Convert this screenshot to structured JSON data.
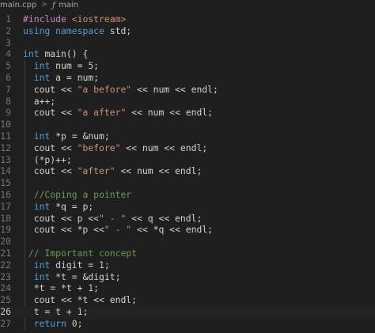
{
  "breadcrumb": {
    "file": "main.cpp",
    "separator": ">",
    "symbol_icon": "function-icon",
    "symbol": "main"
  },
  "editor": {
    "current_line": 26,
    "lines": [
      {
        "n": "1",
        "tokens": [
          [
            "pp",
            "#include "
          ],
          [
            "str",
            "<iostream>"
          ]
        ]
      },
      {
        "n": "2",
        "tokens": [
          [
            "kw",
            "using namespace "
          ],
          [
            "plain",
            "std;"
          ]
        ]
      },
      {
        "n": "3",
        "tokens": []
      },
      {
        "n": "4",
        "tokens": [
          [
            "kw",
            "int "
          ],
          [
            "plain",
            "main() {"
          ]
        ]
      },
      {
        "n": "5",
        "tokens": [
          [
            "plain",
            "  "
          ],
          [
            "kw",
            "int "
          ],
          [
            "plain",
            "num = "
          ],
          [
            "num",
            "5"
          ],
          [
            "plain",
            ";"
          ]
        ]
      },
      {
        "n": "6",
        "tokens": [
          [
            "plain",
            "  "
          ],
          [
            "kw",
            "int "
          ],
          [
            "plain",
            "a = num;"
          ]
        ]
      },
      {
        "n": "7",
        "tokens": [
          [
            "plain",
            "  cout << "
          ],
          [
            "str",
            "\"a before\""
          ],
          [
            "plain",
            " << num << endl;"
          ]
        ]
      },
      {
        "n": "8",
        "tokens": [
          [
            "plain",
            "  a++;"
          ]
        ]
      },
      {
        "n": "9",
        "tokens": [
          [
            "plain",
            "  cout << "
          ],
          [
            "str",
            "\"a after\""
          ],
          [
            "plain",
            " << num << endl;"
          ]
        ]
      },
      {
        "n": "10",
        "tokens": []
      },
      {
        "n": "11",
        "tokens": [
          [
            "plain",
            "  "
          ],
          [
            "kw",
            "int "
          ],
          [
            "plain",
            "*p = &num;"
          ]
        ]
      },
      {
        "n": "12",
        "tokens": [
          [
            "plain",
            "  cout << "
          ],
          [
            "str",
            "\"before\""
          ],
          [
            "plain",
            " << num << endl;"
          ]
        ]
      },
      {
        "n": "13",
        "tokens": [
          [
            "plain",
            "  (*p)++;"
          ]
        ]
      },
      {
        "n": "14",
        "tokens": [
          [
            "plain",
            "  cout << "
          ],
          [
            "str",
            "\"after\""
          ],
          [
            "plain",
            " << num << endl;"
          ]
        ]
      },
      {
        "n": "15",
        "tokens": []
      },
      {
        "n": "16",
        "tokens": [
          [
            "plain",
            "  "
          ],
          [
            "cm",
            "//Coping a pointer"
          ]
        ]
      },
      {
        "n": "17",
        "tokens": [
          [
            "plain",
            "  "
          ],
          [
            "kw",
            "int "
          ],
          [
            "plain",
            "*q = p;"
          ]
        ]
      },
      {
        "n": "18",
        "tokens": [
          [
            "plain",
            "  cout << p <<"
          ],
          [
            "str",
            "\" - \""
          ],
          [
            "plain",
            " << q << endl;"
          ]
        ]
      },
      {
        "n": "19",
        "tokens": [
          [
            "plain",
            "  cout << *p <<"
          ],
          [
            "str",
            "\" - \""
          ],
          [
            "plain",
            " << *q << endl;"
          ]
        ]
      },
      {
        "n": "20",
        "tokens": []
      },
      {
        "n": "21",
        "tokens": [
          [
            "plain",
            " "
          ],
          [
            "cm",
            "// Important concept"
          ]
        ]
      },
      {
        "n": "22",
        "tokens": [
          [
            "plain",
            "  "
          ],
          [
            "kw",
            "int "
          ],
          [
            "plain",
            "digit = "
          ],
          [
            "num",
            "1"
          ],
          [
            "plain",
            ";"
          ]
        ]
      },
      {
        "n": "23",
        "tokens": [
          [
            "plain",
            "  "
          ],
          [
            "kw",
            "int "
          ],
          [
            "plain",
            "*t = &digit;"
          ]
        ]
      },
      {
        "n": "24",
        "tokens": [
          [
            "plain",
            "  *t = *t + "
          ],
          [
            "num",
            "1"
          ],
          [
            "plain",
            ";"
          ]
        ]
      },
      {
        "n": "25",
        "tokens": [
          [
            "plain",
            "  cout << *t << endl;"
          ]
        ]
      },
      {
        "n": "26",
        "tokens": [
          [
            "plain",
            "  t = t + "
          ],
          [
            "num",
            "1"
          ],
          [
            "plain",
            ";"
          ]
        ]
      },
      {
        "n": "27",
        "tokens": [
          [
            "plain",
            "  "
          ],
          [
            "kw",
            "return "
          ],
          [
            "num",
            "0"
          ],
          [
            "plain",
            ";"
          ]
        ]
      }
    ]
  }
}
